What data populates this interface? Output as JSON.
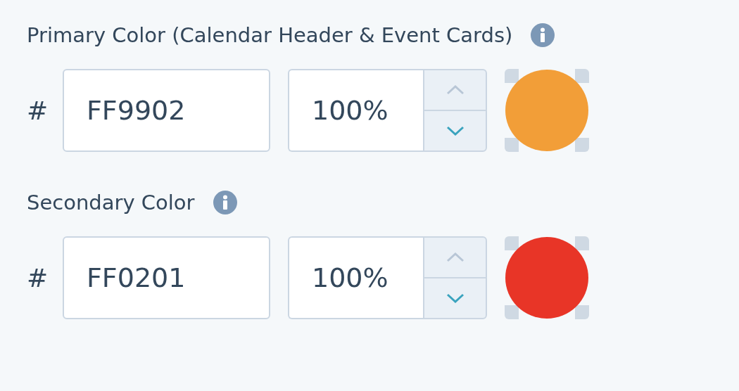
{
  "colors": [
    {
      "label": "Primary Color (Calendar Header & Event Cards)",
      "prefix": "#",
      "hex": "FF9902",
      "opacity": "100%",
      "up_disabled": true,
      "down_disabled": false,
      "color": "#f29e38"
    },
    {
      "label": "Secondary Color",
      "prefix": "#",
      "hex": "FF0201",
      "opacity": "100%",
      "up_disabled": true,
      "down_disabled": false,
      "color": "#e83527"
    }
  ]
}
